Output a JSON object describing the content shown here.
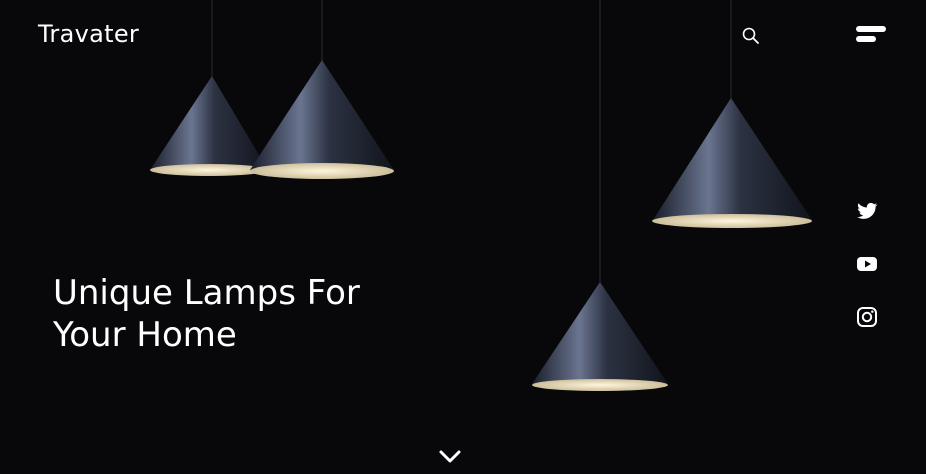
{
  "brand": {
    "name": "Travater"
  },
  "header": {
    "icons": [
      "search-icon",
      "menu-icon"
    ]
  },
  "hero": {
    "line1": "Unique Lamps For",
    "line2": "Your Home"
  },
  "social": [
    "twitter-icon",
    "youtube-icon",
    "instagram-icon"
  ],
  "footer": {
    "icon": "chevron-down-icon"
  },
  "colors": {
    "background": "#08080b",
    "lamp_shade": "#3a4257",
    "lamp_glow": "#f2e8cf",
    "text": "#ffffff"
  }
}
